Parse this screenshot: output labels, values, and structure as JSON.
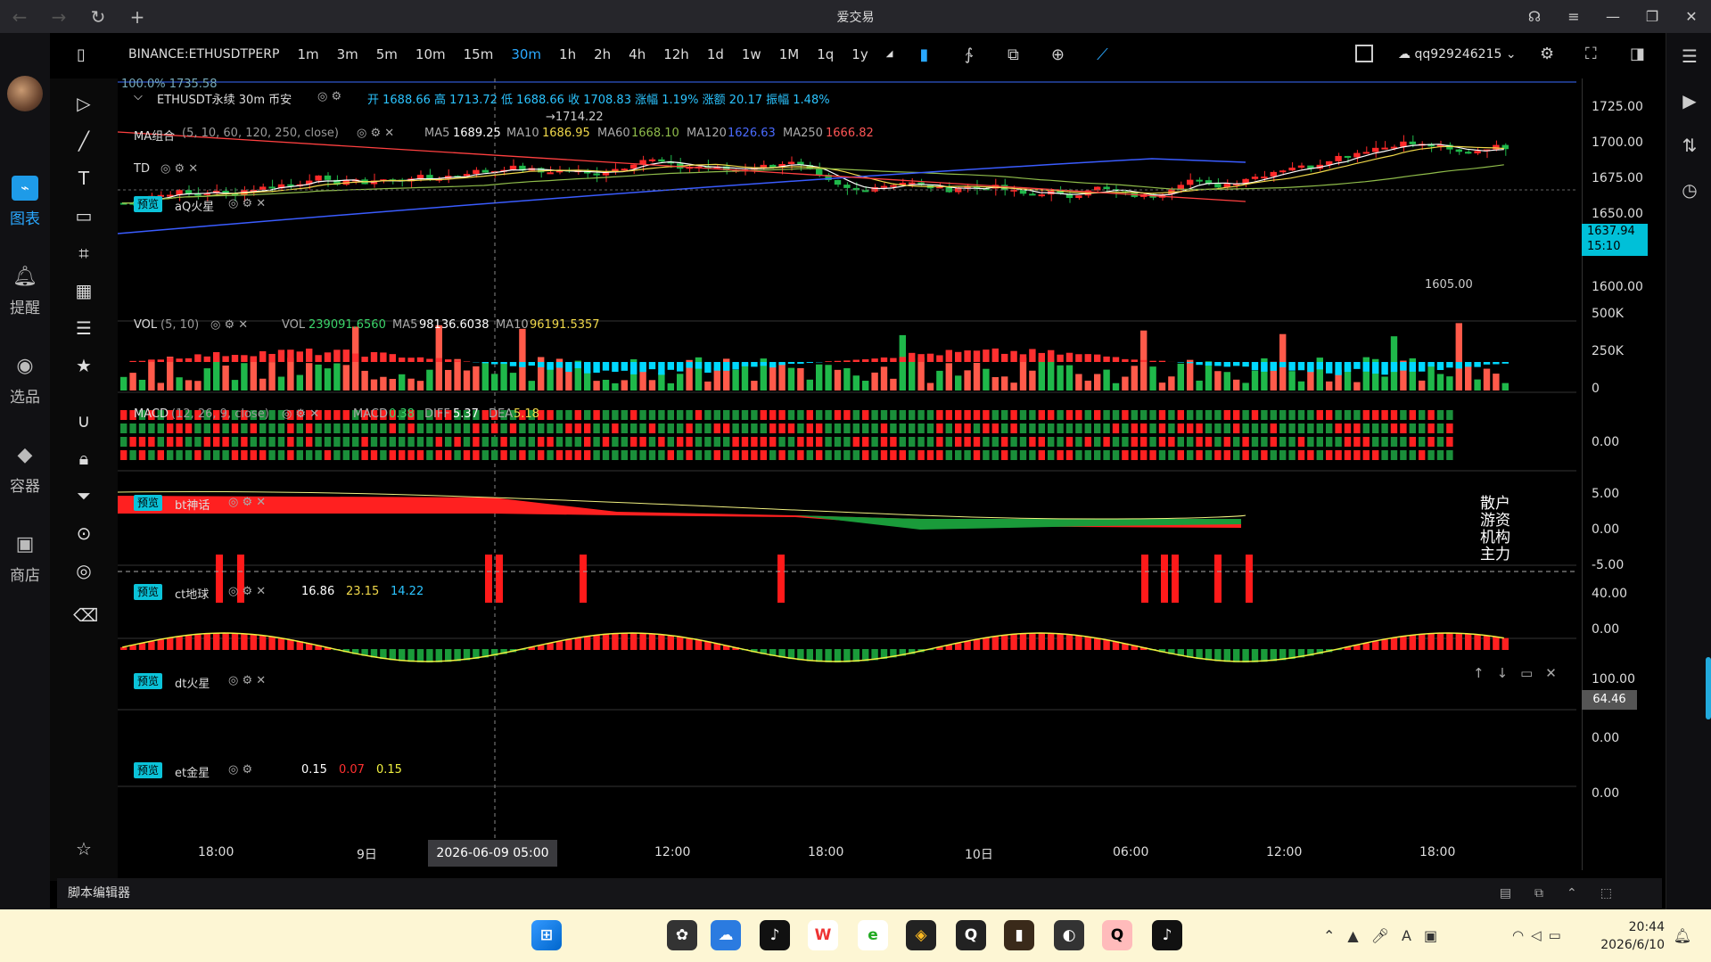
{
  "window": {
    "title": "爱交易"
  },
  "nav": {
    "items": [
      {
        "label": "图表",
        "active": true
      },
      {
        "label": "提醒"
      },
      {
        "label": "选品"
      },
      {
        "label": "容器"
      },
      {
        "label": "商店"
      }
    ]
  },
  "toolbar": {
    "symbol": "BINANCE:ETHUSDTPERP",
    "timeframes": [
      "1m",
      "3m",
      "5m",
      "10m",
      "15m",
      "30m",
      "1h",
      "2h",
      "4h",
      "12h",
      "1d",
      "1w",
      "1M",
      "1q",
      "1y"
    ],
    "active_tf": "30m",
    "user": "qq929246215"
  },
  "header": {
    "scale": "100.0% 1735.58",
    "symbol_line": "ETHUSDT永续 30m 币安",
    "ohlc": "开 1688.66 高 1713.72 低 1688.66 收 1708.83 涨幅 1.19% 涨额 20.17 振幅 1.48%",
    "ma_label": "MA组合",
    "ma_params": "(5, 10, 60, 120, 250, close)",
    "ma5": "1689.25",
    "ma10": "1686.95",
    "ma60": "1668.10",
    "ma120": "1626.63",
    "ma250": "1666.82",
    "ma5_name": "MA5",
    "ma10_name": "MA10",
    "ma60_name": "MA60",
    "ma120_name": "MA120",
    "ma250_name": "MA250",
    "td": "TD",
    "aq": "aQ火星",
    "preview": "预览",
    "high_mark": "→1714.22",
    "low_mark": "1605.00"
  },
  "price_axis": [
    "1725.00",
    "1700.00",
    "1675.00",
    "1650.00",
    "1600.00"
  ],
  "price_tag": {
    "price": "1637.94",
    "time": "15:10"
  },
  "vol": {
    "label": "VOL",
    "params": "(5, 10)",
    "vol": "VOL",
    "vol_val": "239091.6560",
    "ma5": "MA5",
    "ma5_val": "98136.6038",
    "ma10": "MA10",
    "ma10_val": "96191.5357",
    "axis": [
      "500K",
      "250K",
      "0"
    ]
  },
  "macd": {
    "label": "MACD",
    "params": "(12, 26, 9, close)",
    "macd": "MACD",
    "macd_val": "0.38",
    "diff": "DIFF",
    "diff_val": "5.37",
    "dea": "DEA",
    "dea_val": "5.18",
    "axis": [
      "0.00"
    ]
  },
  "bt": {
    "label": "bt神话",
    "axis": [
      "5.00",
      "0.00",
      "-5.00"
    ],
    "rows": [
      "散户",
      "游资",
      "机构",
      "主力"
    ]
  },
  "ct": {
    "label": "ct地球",
    "v1": "16.86",
    "v2": "23.15",
    "v3": "14.22",
    "axis": [
      "40.00",
      "0.00"
    ]
  },
  "dt": {
    "label": "dt火星",
    "axis": [
      "100.00",
      "0.00"
    ],
    "tag": "64.46"
  },
  "et": {
    "label": "et金星",
    "v1": "0.15",
    "v2": "0.07",
    "v3": "0.15",
    "axis": [
      "0.00"
    ]
  },
  "time_axis": [
    "18:00",
    "9日",
    "12:00",
    "18:00",
    "10日",
    "06:00",
    "12:00",
    "18:00"
  ],
  "crosshair_date": "2026-06-09 05:00",
  "bottom": {
    "editor": "脚本编辑器"
  },
  "clock": {
    "time": "20:44",
    "date": "2026/6/10"
  }
}
